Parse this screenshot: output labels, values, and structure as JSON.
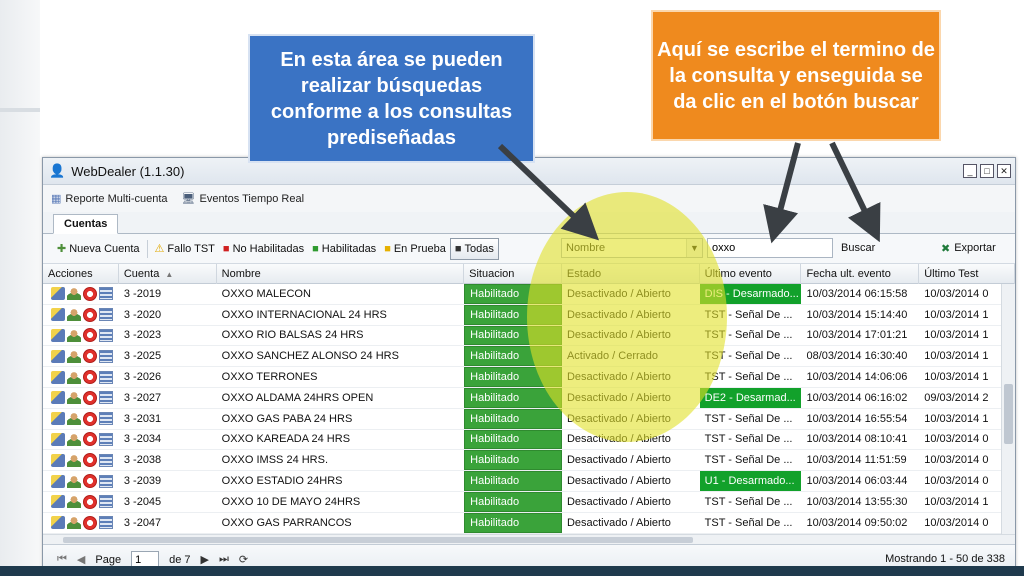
{
  "callouts": {
    "left": "En esta área se pueden realizar búsquedas conforme a los consultas prediseñadas",
    "right": "Aquí se escribe el termino de la consulta y enseguida se da clic en el botón buscar"
  },
  "window": {
    "title": "WebDealer (1.1.30)",
    "controls": [
      "_",
      "□",
      "✕"
    ]
  },
  "menu": {
    "multi_account": "Reporte Multi-cuenta",
    "real_time": "Eventos Tiempo Real"
  },
  "tabs": {
    "active": "Cuentas"
  },
  "toolbar": {
    "new_account": "Nueva Cuenta",
    "fallo_tst": "Fallo TST",
    "no_habilitadas": "No Habilitadas",
    "habilitadas": "Habilitadas",
    "en_prueba": "En Prueba",
    "todas": "Todas",
    "field_select_value": "Nombre",
    "search_value": "oxxo",
    "search_button": "Buscar",
    "export_button": "Exportar"
  },
  "grid": {
    "headers": {
      "acciones": "Acciones",
      "cuenta": "Cuenta",
      "nombre": "Nombre",
      "situacion": "Situacion",
      "estado": "Estado",
      "ultimo_evento": "Último evento",
      "fecha_ult_evento": "Fecha ult. evento",
      "ultimo_test": "Último Test"
    },
    "rows": [
      {
        "cuenta": "3 -2019",
        "nombre": "OXXO MALECON",
        "situacion": "Habilitado",
        "estado": "Desactivado / Abierto",
        "evento": "DIS - Desarmado...",
        "evento_color": "#12a12b",
        "fecha": "10/03/2014 06:15:58",
        "test": "10/03/2014 0"
      },
      {
        "cuenta": "3 -2020",
        "nombre": "OXXO INTERNACIONAL 24 HRS",
        "situacion": "Habilitado",
        "estado": "Desactivado / Abierto",
        "evento": "TST - Señal De ...",
        "evento_color": "",
        "fecha": "10/03/2014 15:14:40",
        "test": "10/03/2014 1"
      },
      {
        "cuenta": "3 -2023",
        "nombre": "OXXO RIO BALSAS 24 HRS",
        "situacion": "Habilitado",
        "estado": "Desactivado / Abierto",
        "evento": "TST - Señal De ...",
        "evento_color": "",
        "fecha": "10/03/2014 17:01:21",
        "test": "10/03/2014 1"
      },
      {
        "cuenta": "3 -2025",
        "nombre": "OXXO SANCHEZ ALONSO 24 HRS",
        "situacion": "Habilitado",
        "estado": "Activado / Cerrado",
        "evento": "TST - Señal De ...",
        "evento_color": "",
        "fecha": "08/03/2014 16:30:40",
        "test": "10/03/2014 1"
      },
      {
        "cuenta": "3 -2026",
        "nombre": "OXXO TERRONES",
        "situacion": "Habilitado",
        "estado": "Desactivado / Abierto",
        "evento": "TST - Señal De ...",
        "evento_color": "",
        "fecha": "10/03/2014 14:06:06",
        "test": "10/03/2014 1"
      },
      {
        "cuenta": "3 -2027",
        "nombre": "OXXO ALDAMA 24HRS OPEN",
        "situacion": "Habilitado",
        "estado": "Desactivado / Abierto",
        "evento": "DE2 - Desarmad...",
        "evento_color": "#12a12b",
        "fecha": "10/03/2014 06:16:02",
        "test": "09/03/2014 2"
      },
      {
        "cuenta": "3 -2031",
        "nombre": "OXXO GAS PABA 24 HRS",
        "situacion": "Habilitado",
        "estado": "Desactivado / Abierto",
        "evento": "TST - Señal De ...",
        "evento_color": "",
        "fecha": "10/03/2014 16:55:54",
        "test": "10/03/2014 1"
      },
      {
        "cuenta": "3 -2034",
        "nombre": "OXXO KAREADA 24 HRS",
        "situacion": "Habilitado",
        "estado": "Desactivado / Abierto",
        "evento": "TST - Señal De ...",
        "evento_color": "",
        "fecha": "10/03/2014 08:10:41",
        "test": "10/03/2014 0"
      },
      {
        "cuenta": "3 -2038",
        "nombre": "OXXO IMSS 24 HRS.",
        "situacion": "Habilitado",
        "estado": "Desactivado / Abierto",
        "evento": "TST - Señal De ...",
        "evento_color": "",
        "fecha": "10/03/2014 11:51:59",
        "test": "10/03/2014 0"
      },
      {
        "cuenta": "3 -2039",
        "nombre": "OXXO ESTADIO 24HRS",
        "situacion": "Habilitado",
        "estado": "Desactivado / Abierto",
        "evento": "U1 - Desarmado...",
        "evento_color": "#12a12b",
        "fecha": "10/03/2014 06:03:44",
        "test": "10/03/2014 0"
      },
      {
        "cuenta": "3 -2045",
        "nombre": "OXXO 10 DE MAYO 24HRS",
        "situacion": "Habilitado",
        "estado": "Desactivado / Abierto",
        "evento": "TST - Señal De ...",
        "evento_color": "",
        "fecha": "10/03/2014 13:55:30",
        "test": "10/03/2014 1"
      },
      {
        "cuenta": "3 -2047",
        "nombre": "OXXO GAS PARRANCOS",
        "situacion": "Habilitado",
        "estado": "Desactivado / Abierto",
        "evento": "TST - Señal De ...",
        "evento_color": "",
        "fecha": "10/03/2014 09:50:02",
        "test": "10/03/2014 0"
      }
    ]
  },
  "pager": {
    "page_label": "Page",
    "page_value": "1",
    "of_label": "de 7",
    "info": "Mostrando 1 - 50 de 338"
  },
  "colors": {
    "situacion_bg": "#3aa33a",
    "evento_green": "#12a12b",
    "callout_blue": "#3a73c4",
    "callout_orange": "#ef8a1e",
    "highlight": "#e1e128"
  }
}
